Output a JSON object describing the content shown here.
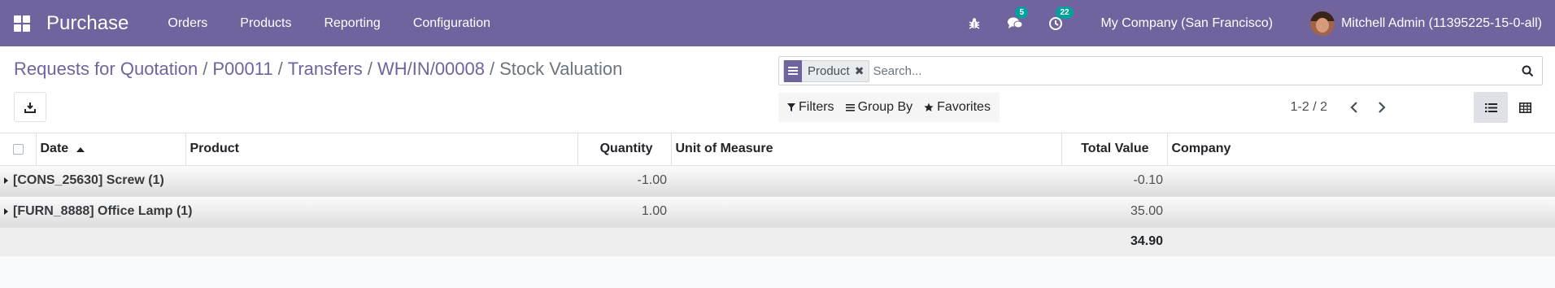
{
  "navbar": {
    "app_name": "Purchase",
    "menu": [
      "Orders",
      "Products",
      "Reporting",
      "Configuration"
    ],
    "messages_count": "5",
    "activities_count": "22",
    "company": "My Company (San Francisco)",
    "user": "Mitchell Admin (11395225-15-0-all)",
    "colors": {
      "bar": "#71639e",
      "badge": "#00a09d"
    }
  },
  "breadcrumb": {
    "items": [
      "Requests for Quotation",
      "P00011",
      "Transfers",
      "WH/IN/00008"
    ],
    "separator": "/",
    "active": "Stock Valuation"
  },
  "search": {
    "facet_value": "Product",
    "placeholder": "Search...",
    "filters_label": "Filters",
    "groupby_label": "Group By",
    "favorites_label": "Favorites"
  },
  "pager": {
    "value": "1-2 / 2"
  },
  "table": {
    "columns": [
      "Date",
      "Product",
      "Quantity",
      "Unit of Measure",
      "Total Value",
      "Company"
    ],
    "groups": [
      {
        "label": "[CONS_25630] Screw (1)",
        "quantity": "-1.00",
        "total_value": "-0.10"
      },
      {
        "label": "[FURN_8888] Office Lamp (1)",
        "quantity": "1.00",
        "total_value": "35.00"
      }
    ],
    "footer_total": "34.90"
  }
}
